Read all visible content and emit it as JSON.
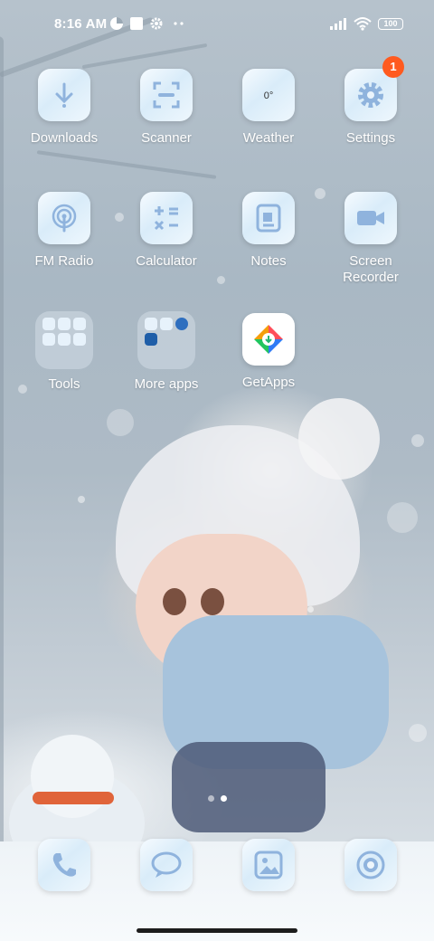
{
  "status_bar": {
    "time": "8:16 AM",
    "battery": "100"
  },
  "apps": [
    {
      "name": "Downloads",
      "icon": "download-icon"
    },
    {
      "name": "Scanner",
      "icon": "scanner-icon"
    },
    {
      "name": "Weather",
      "icon": "weather-icon",
      "tile_text": "0°"
    },
    {
      "name": "Settings",
      "icon": "gear-icon",
      "badge": "1"
    },
    {
      "name": "FM Radio",
      "icon": "radio-icon"
    },
    {
      "name": "Calculator",
      "icon": "calculator-icon"
    },
    {
      "name": "Notes",
      "icon": "notes-icon"
    },
    {
      "name": "Screen\nRecorder",
      "icon": "video-camera-icon"
    },
    {
      "name": "Tools",
      "icon": "folder-icon"
    },
    {
      "name": "More apps",
      "icon": "folder-icon"
    },
    {
      "name": "GetApps",
      "icon": "getapps-icon"
    }
  ],
  "dock": [
    {
      "name": "Phone",
      "icon": "phone-icon"
    },
    {
      "name": "Messages",
      "icon": "chat-bubble-icon"
    },
    {
      "name": "Gallery",
      "icon": "gallery-icon"
    },
    {
      "name": "Camera",
      "icon": "camera-icon"
    }
  ],
  "page_indicator": {
    "pages": 2,
    "current": 2
  },
  "colors": {
    "badge": "#ff5a1f",
    "icon_blue": "#8fb3dd",
    "tile_bg": "#e3f0fa"
  }
}
